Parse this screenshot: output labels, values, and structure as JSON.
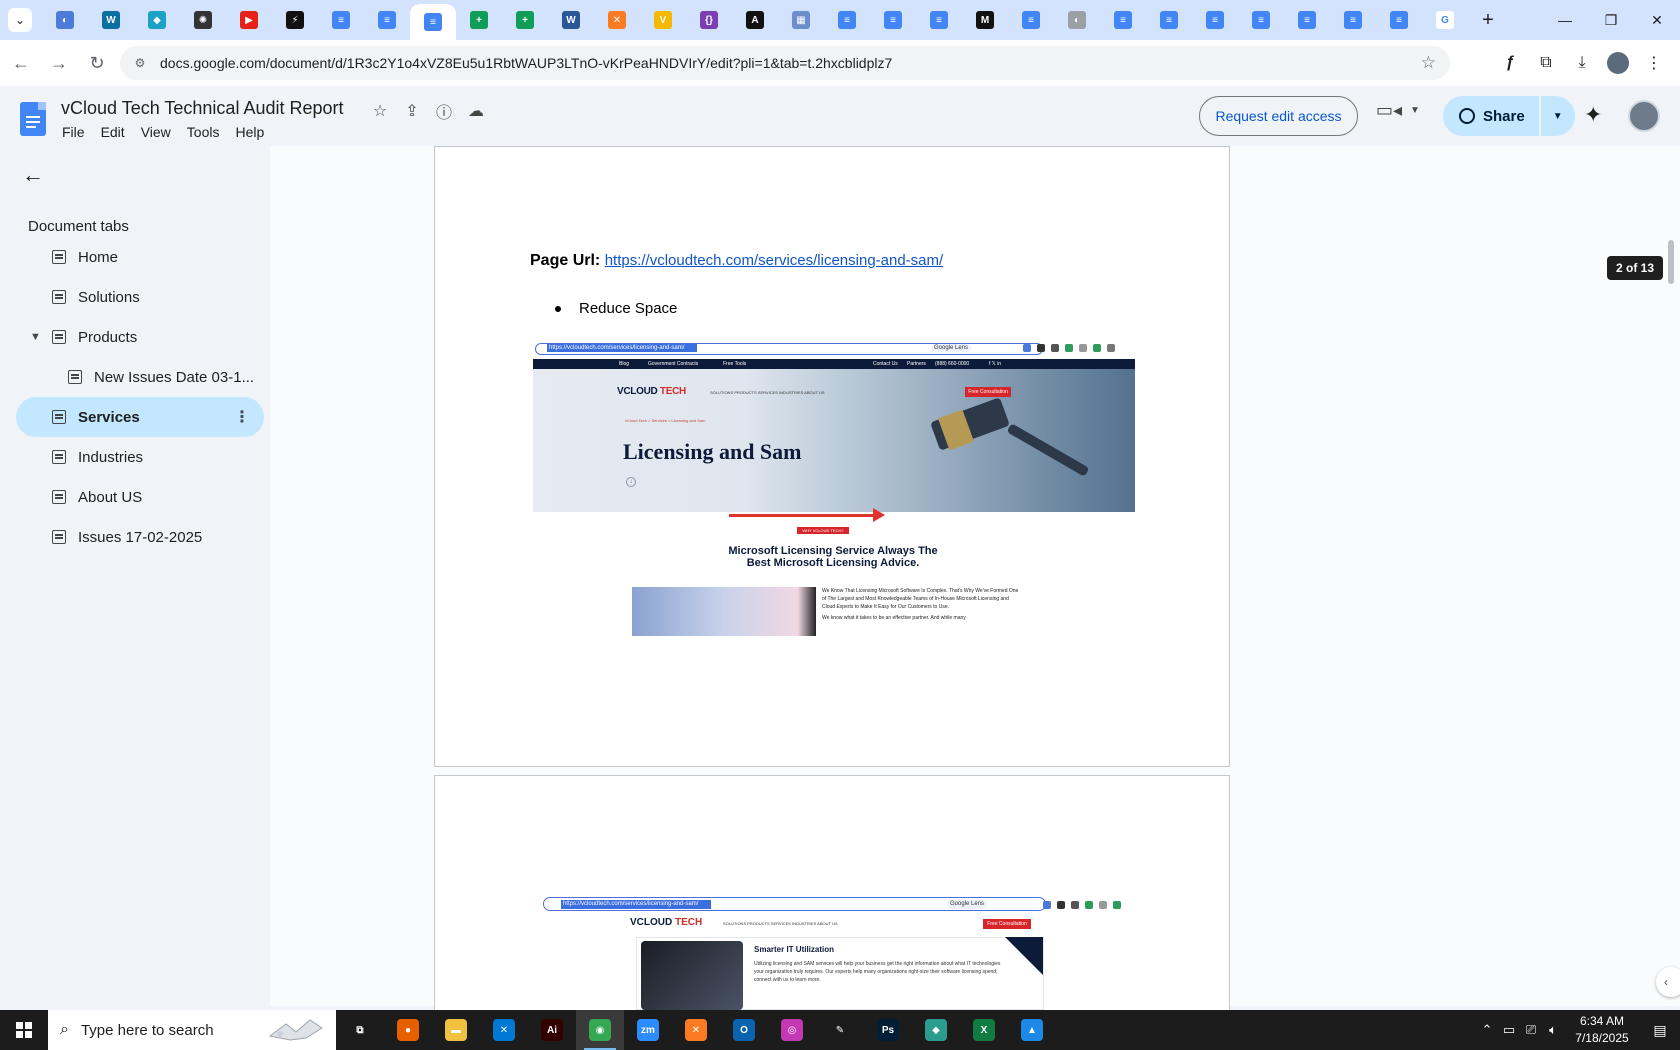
{
  "browser": {
    "tabs": [
      {
        "icon": "globe-icon",
        "color": "#4c7bd9",
        "glyph": "◐"
      },
      {
        "icon": "wordpress-icon",
        "color": "#0b6fa4",
        "glyph": "W"
      },
      {
        "icon": "app-icon",
        "color": "#1aa3c4",
        "glyph": "◆"
      },
      {
        "icon": "openai-icon",
        "color": "#333333",
        "glyph": "✺"
      },
      {
        "icon": "youtube-icon",
        "color": "#e62117",
        "glyph": "▶"
      },
      {
        "icon": "bolt-icon",
        "color": "#111111",
        "glyph": "⚡"
      },
      {
        "icon": "docs-icon",
        "color": "#4285f4",
        "glyph": "≡"
      },
      {
        "icon": "docs-icon",
        "color": "#4285f4",
        "glyph": "≡"
      },
      {
        "icon": "docs-icon",
        "color": "#4285f4",
        "glyph": "≡",
        "active": true
      },
      {
        "icon": "sheets-icon",
        "color": "#0f9d58",
        "glyph": "+"
      },
      {
        "icon": "sheets-icon",
        "color": "#0f9d58",
        "glyph": "+"
      },
      {
        "icon": "word-icon",
        "color": "#2b579a",
        "glyph": "W"
      },
      {
        "icon": "xampp-icon",
        "color": "#fb7a24",
        "glyph": "✕"
      },
      {
        "icon": "vite-icon",
        "color": "#f5b800",
        "glyph": "V"
      },
      {
        "icon": "json-icon",
        "color": "#7b3fb5",
        "glyph": "{}"
      },
      {
        "icon": "app-icon",
        "color": "#111111",
        "glyph": "A"
      },
      {
        "icon": "grid-icon",
        "color": "#6b8ecf",
        "glyph": "▦"
      },
      {
        "icon": "docs-icon",
        "color": "#4285f4",
        "glyph": "≡"
      },
      {
        "icon": "docs-icon",
        "color": "#4285f4",
        "glyph": "≡"
      },
      {
        "icon": "docs-icon",
        "color": "#4285f4",
        "glyph": "≡"
      },
      {
        "icon": "medium-icon",
        "color": "#111111",
        "glyph": "M"
      },
      {
        "icon": "docs-icon",
        "color": "#4285f4",
        "glyph": "≡"
      },
      {
        "icon": "globe-icon",
        "color": "#9aa0a6",
        "glyph": "◐"
      },
      {
        "icon": "docs-icon",
        "color": "#4285f4",
        "glyph": "≡"
      },
      {
        "icon": "docs-icon",
        "color": "#4285f4",
        "glyph": "≡"
      },
      {
        "icon": "docs-icon",
        "color": "#4285f4",
        "glyph": "≡"
      },
      {
        "icon": "docs-icon",
        "color": "#4285f4",
        "glyph": "≡"
      },
      {
        "icon": "docs-icon",
        "color": "#4285f4",
        "glyph": "≡"
      },
      {
        "icon": "docs-icon",
        "color": "#4285f4",
        "glyph": "≡"
      },
      {
        "icon": "docs-icon",
        "color": "#4285f4",
        "glyph": "≡"
      },
      {
        "icon": "google-icon",
        "color": "#ffffff",
        "glyph": "G"
      }
    ],
    "url": "docs.google.com/document/d/1R3c2Y1o4xVZ8Eu5u1RbtWAUP3LTnO-vKrPeaHNDVIrY/edit?pli=1&tab=t.2hxcblidplz7"
  },
  "docs": {
    "title": "vCloud Tech Technical Audit Report",
    "menu": [
      "File",
      "Edit",
      "View",
      "Tools",
      "Help"
    ],
    "request_edit_label": "Request edit access",
    "share_label": "Share"
  },
  "sidebar": {
    "heading": "Document tabs",
    "items": [
      {
        "label": "Home"
      },
      {
        "label": "Solutions"
      },
      {
        "label": "Products"
      },
      {
        "label": "New Issues Date 03-1..."
      },
      {
        "label": "Services"
      },
      {
        "label": "Industries"
      },
      {
        "label": "About US"
      },
      {
        "label": "Issues 17-02-2025"
      }
    ]
  },
  "document": {
    "page_url_label": "Page Url:",
    "page_url": "https://vcloudtech.com/services/licensing-and-sam/",
    "bullet": "Reduce Space",
    "page_counter": "2 of 13"
  },
  "shot1": {
    "address": "https://vcloudtech.com/services/licensing-and-sam/",
    "lens": "Google Lens",
    "topbar": {
      "blog": "Blog",
      "gov": "Government Contracts",
      "tools": "Free Tools",
      "contact": "Contact Us",
      "partners": "Partners",
      "phone": "(888) 660-0000"
    },
    "logo_main": "VCLOUD",
    "logo_accent": "TECH",
    "nav": "SOLUTIONS   PRODUCTS   SERVICES   INDUSTRIES   ABOUT US",
    "cta": "Free Consultation",
    "crumb": "vCloud Tech  >  Services  >  Licensing and Sam",
    "hero_title": "Licensing and Sam",
    "badge": "WHY VCLOUD TECH?",
    "heading_line1": "Microsoft Licensing Service Always The",
    "heading_line2": "Best Microsoft Licensing Advice.",
    "paragraph": "We Know That Licensing Microsoft Software Is Complex. That's Why We've Formed One of The Largest and Most Knowledgeable Teams of In-House Microsoft Licensing and Cloud Experts to Make It Easy for Our Customers to Use.",
    "paragraph2": "We know what it takes to be an effective partner. And while many"
  },
  "shot2": {
    "address": "https://vcloudtech.com/services/licensing-and-sam/",
    "lens": "Google Lens",
    "logo_main": "VCLOUD",
    "logo_accent": "TECH",
    "nav": "SOLUTIONS   PRODUCTS   SERVICES   INDUSTRIES   ABOUT US",
    "cta": "Free Consultation",
    "card_title": "Smarter IT Utilization",
    "card_text": "Utilizing licensing and SAM services will help your business get the right information about what IT technologies your organization truly requires. Our experts help many organizations right-size their software licensing spend; connect with us to learn more."
  },
  "taskbar": {
    "search_placeholder": "Type here to search",
    "apps": [
      {
        "icon": "task-view-icon",
        "color": "#1c1c1c",
        "glyph": "⧉"
      },
      {
        "icon": "firefox-icon",
        "color": "#e66000",
        "glyph": "●"
      },
      {
        "icon": "file-explorer-icon",
        "color": "#f0c040",
        "glyph": "▬"
      },
      {
        "icon": "vscode-icon",
        "color": "#0078d4",
        "glyph": "✕"
      },
      {
        "icon": "illustrator-icon",
        "color": "#330000",
        "glyph": "Ai"
      },
      {
        "icon": "chrome-icon",
        "color": "#34a853",
        "glyph": "◉",
        "active": true
      },
      {
        "icon": "zoom-icon",
        "color": "#2d8cff",
        "glyph": "zm"
      },
      {
        "icon": "xampp-icon",
        "color": "#fb7a24",
        "glyph": "✕"
      },
      {
        "icon": "outlook-icon",
        "color": "#0a64ad",
        "glyph": "O"
      },
      {
        "icon": "app-icon",
        "color": "#c239b3",
        "glyph": "◎"
      },
      {
        "icon": "pen-icon",
        "color": "#1c1c1c",
        "glyph": "✎"
      },
      {
        "icon": "photoshop-icon",
        "color": "#001e36",
        "glyph": "Ps"
      },
      {
        "icon": "app-icon",
        "color": "#2a9d8f",
        "glyph": "◆"
      },
      {
        "icon": "excel-icon",
        "color": "#107c41",
        "glyph": "X"
      },
      {
        "icon": "paint-icon",
        "color": "#1e88e5",
        "glyph": "▲"
      }
    ],
    "time": "6:34 AM",
    "date": "7/18/2025"
  }
}
